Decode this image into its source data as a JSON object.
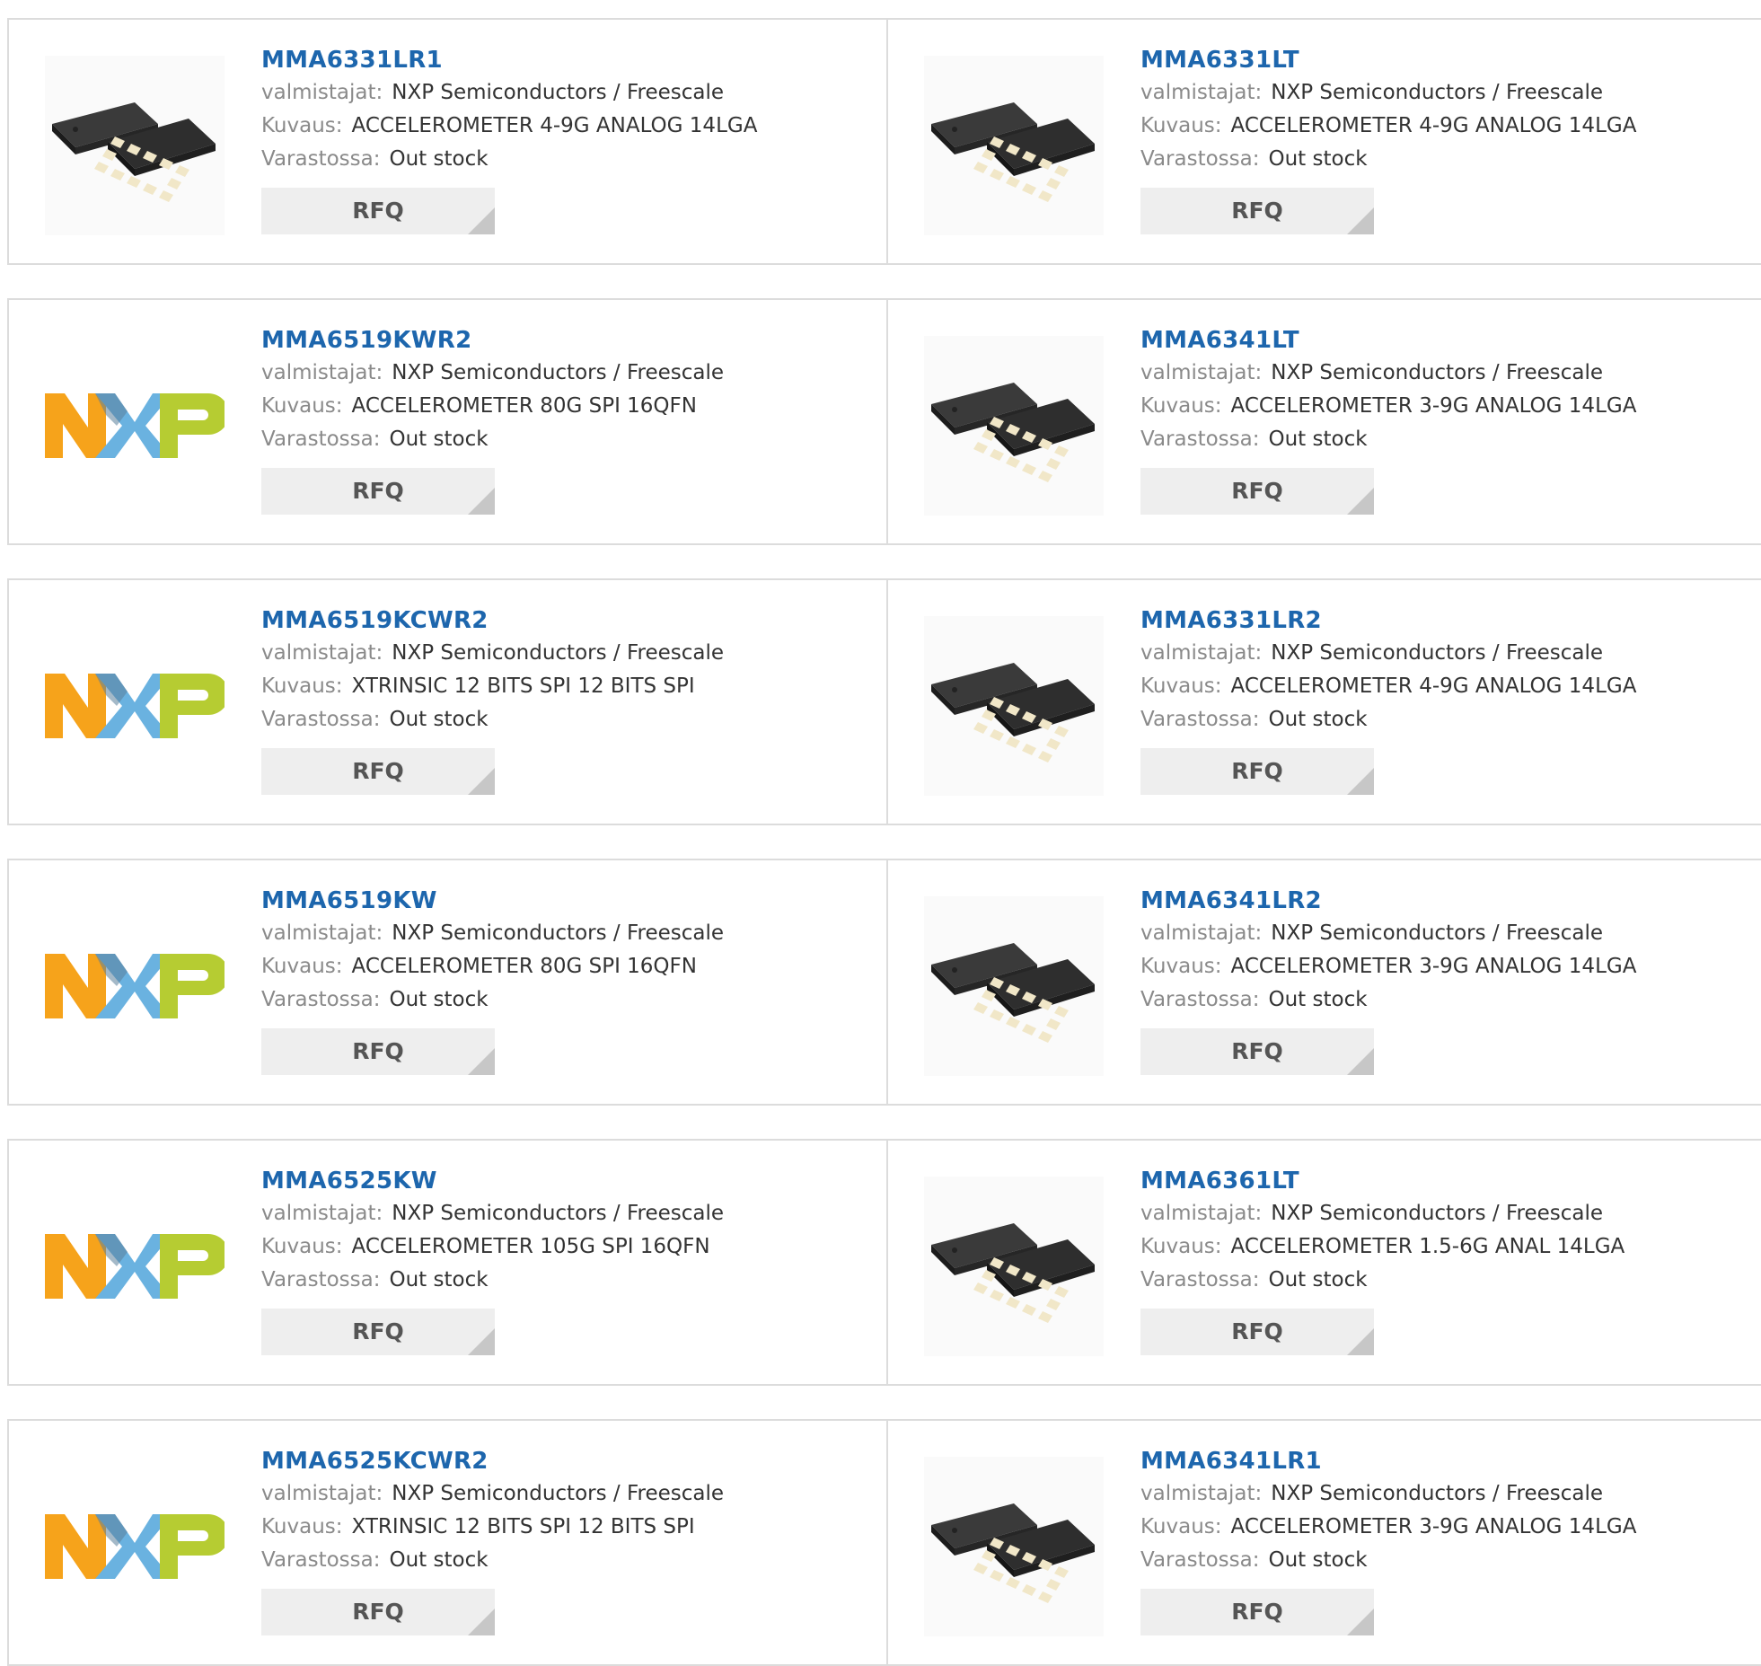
{
  "labels": {
    "manufacturer": "valmistajat:",
    "description": "Kuvaus:",
    "stock": "Varastossa:",
    "rfq": "RFQ"
  },
  "colors": {
    "title": "#1d66ad",
    "nxp_orange": "#f6a31b",
    "nxp_blue": "#6ab2e0",
    "nxp_green": "#b6cc32"
  },
  "rows": [
    {
      "left": {
        "part": "MMA6331LR1",
        "image": "lga-chip-image",
        "manufacturer": "NXP Semiconductors / Freescale",
        "description": "ACCELEROMETER 4-9G ANALOG 14LGA",
        "stock": "Out stock"
      },
      "right": {
        "part": "MMA6331LT",
        "image": "lga-chip-image",
        "manufacturer": "NXP Semiconductors / Freescale",
        "description": "ACCELEROMETER 4-9G ANALOG 14LGA",
        "stock": "Out stock"
      }
    },
    {
      "left": {
        "part": "MMA6519KWR2",
        "image": "nxp-logo",
        "manufacturer": "NXP Semiconductors / Freescale",
        "description": "ACCELEROMETER 80G SPI 16QFN",
        "stock": "Out stock"
      },
      "right": {
        "part": "MMA6341LT",
        "image": "lga-chip-image",
        "manufacturer": "NXP Semiconductors / Freescale",
        "description": "ACCELEROMETER 3-9G ANALOG 14LGA",
        "stock": "Out stock"
      }
    },
    {
      "left": {
        "part": "MMA6519KCWR2",
        "image": "nxp-logo",
        "manufacturer": "NXP Semiconductors / Freescale",
        "description": "XTRINSIC 12 BITS SPI 12 BITS SPI",
        "stock": "Out stock"
      },
      "right": {
        "part": "MMA6331LR2",
        "image": "lga-chip-image",
        "manufacturer": "NXP Semiconductors / Freescale",
        "description": "ACCELEROMETER 4-9G ANALOG 14LGA",
        "stock": "Out stock"
      }
    },
    {
      "left": {
        "part": "MMA6519KW",
        "image": "nxp-logo",
        "manufacturer": "NXP Semiconductors / Freescale",
        "description": "ACCELEROMETER 80G SPI 16QFN",
        "stock": "Out stock"
      },
      "right": {
        "part": "MMA6341LR2",
        "image": "lga-chip-image",
        "manufacturer": "NXP Semiconductors / Freescale",
        "description": "ACCELEROMETER 3-9G ANALOG 14LGA",
        "stock": "Out stock"
      }
    },
    {
      "left": {
        "part": "MMA6525KW",
        "image": "nxp-logo",
        "manufacturer": "NXP Semiconductors / Freescale",
        "description": "ACCELEROMETER 105G SPI 16QFN",
        "stock": "Out stock"
      },
      "right": {
        "part": "MMA6361LT",
        "image": "lga-chip-image",
        "manufacturer": "NXP Semiconductors / Freescale",
        "description": "ACCELEROMETER 1.5-6G ANAL 14LGA",
        "stock": "Out stock"
      }
    },
    {
      "left": {
        "part": "MMA6525KCWR2",
        "image": "nxp-logo",
        "manufacturer": "NXP Semiconductors / Freescale",
        "description": "XTRINSIC 12 BITS SPI 12 BITS SPI",
        "stock": "Out stock"
      },
      "right": {
        "part": "MMA6341LR1",
        "image": "lga-chip-image",
        "manufacturer": "NXP Semiconductors / Freescale",
        "description": "ACCELEROMETER 3-9G ANALOG 14LGA",
        "stock": "Out stock"
      }
    }
  ]
}
